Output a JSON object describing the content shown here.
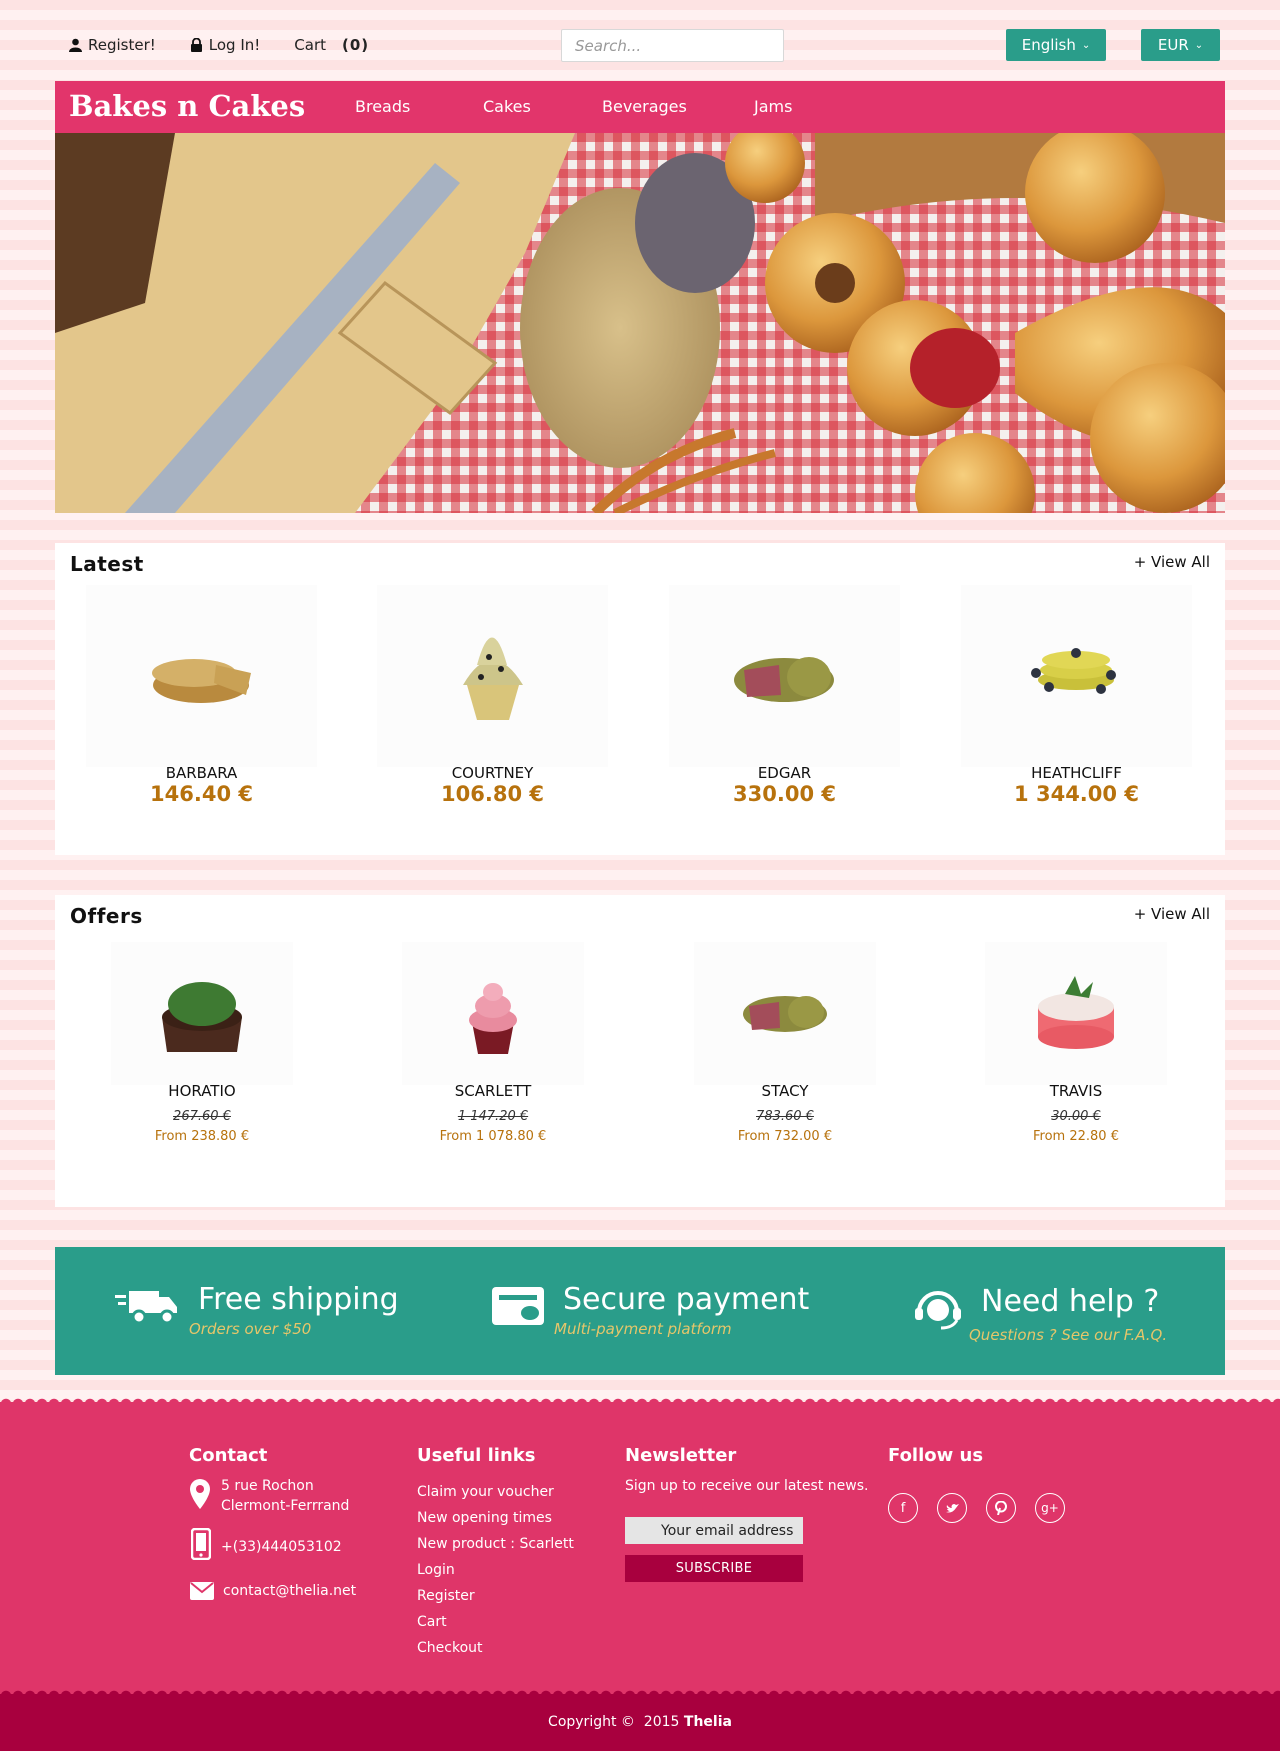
{
  "topbar": {
    "register": "Register!",
    "login": "Log In!",
    "cart": "Cart",
    "cart_count": "(0)",
    "search_placeholder": "Search...",
    "language": "English",
    "currency": "EUR"
  },
  "nav": {
    "brand": "Bakes n Cakes",
    "items": [
      "Breads",
      "Cakes",
      "Beverages",
      "Jams"
    ]
  },
  "latest": {
    "title": "Latest",
    "view_all": "+ View All",
    "products": [
      {
        "name": "BARBARA",
        "price": "146.40 €"
      },
      {
        "name": "COURTNEY",
        "price": "106.80 €"
      },
      {
        "name": "EDGAR",
        "price": "330.00 €"
      },
      {
        "name": "HEATHCLIFF",
        "price": "1 344.00 €"
      }
    ]
  },
  "offers": {
    "title": "Offers",
    "view_all": "+ View All",
    "products": [
      {
        "name": "HORATIO",
        "old_price": "267.60 €",
        "price": "From 238.80 €"
      },
      {
        "name": "SCARLETT",
        "old_price": "1 147.20 €",
        "price": "From 1 078.80 €"
      },
      {
        "name": "STACY",
        "old_price": "783.60 €",
        "price": "From 732.00 €"
      },
      {
        "name": "TRAVIS",
        "old_price": "30.00 €",
        "price": "From 22.80 €"
      }
    ]
  },
  "features": [
    {
      "title": "Free shipping",
      "subtitle": "Orders over $50",
      "icon": "truck-icon"
    },
    {
      "title": "Secure payment",
      "subtitle": "Multi-payment platform",
      "icon": "card-icon"
    },
    {
      "title": "Need help ?",
      "subtitle": "Questions ? See our F.A.Q.",
      "icon": "headset-icon"
    }
  ],
  "footer": {
    "contact": {
      "title": "Contact",
      "address_line1": "5 rue Rochon",
      "address_line2": "Clermont-Ferrrand",
      "phone": "+(33)444053102",
      "email": "contact@thelia.net"
    },
    "links": {
      "title": "Useful links",
      "items": [
        "Claim your voucher",
        "New opening times",
        "New product : Scarlett",
        "Login",
        "Register",
        "Cart",
        "Checkout"
      ]
    },
    "newsletter": {
      "title": "Newsletter",
      "text": "Sign up to receive our latest news.",
      "placeholder": "Your email address",
      "button": "SUBSCRIBE"
    },
    "follow": {
      "title": "Follow us",
      "icons": [
        "facebook-icon",
        "twitter-icon",
        "pinterest-icon",
        "google-plus-icon"
      ]
    },
    "copyright_prefix": "Copyright ©  2015 ",
    "copyright_brand": "Thelia"
  },
  "colors": {
    "brand_pink": "#e2356b",
    "teal": "#2a9d8a",
    "price_gold": "#b7720d",
    "footer_dark": "#a8003e"
  }
}
